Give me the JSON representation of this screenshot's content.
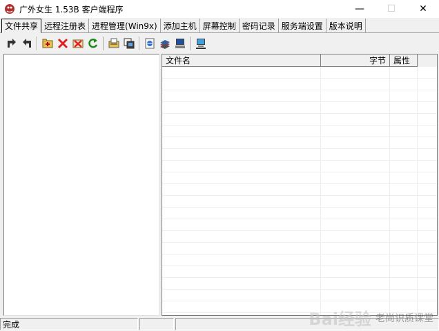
{
  "window": {
    "title": "广外女生 1.53B 客户端程序",
    "minimize_glyph": "—",
    "maximize_glyph": "☐",
    "close_glyph": "✕"
  },
  "tabs": [
    {
      "label": "文件共享",
      "active": true
    },
    {
      "label": "远程注册表"
    },
    {
      "label": "进程管理(Win9x)"
    },
    {
      "label": "添加主机"
    },
    {
      "label": "屏幕控制"
    },
    {
      "label": "密码记录"
    },
    {
      "label": "服务端设置"
    },
    {
      "label": "版本说明"
    }
  ],
  "toolbar": {
    "icons": [
      "forward-arrow-icon",
      "back-arrow-icon",
      "new-folder-icon",
      "delete-icon",
      "delete-folder-icon",
      "refresh-icon",
      "upload-icon",
      "download-icon",
      "browser-icon",
      "books-icon",
      "computer-icon",
      "network-computer-icon"
    ]
  },
  "file_list": {
    "columns": [
      "文件名",
      "字节",
      "属性"
    ],
    "rows": []
  },
  "status": {
    "text": "完成"
  },
  "watermark": {
    "logo": "Bai经验",
    "text": "老尚识质课堂"
  },
  "colors": {
    "background": "#f0f0f0",
    "pane": "#ffffff",
    "delete_red": "#e02020",
    "refresh_green": "#1a8a1a"
  }
}
